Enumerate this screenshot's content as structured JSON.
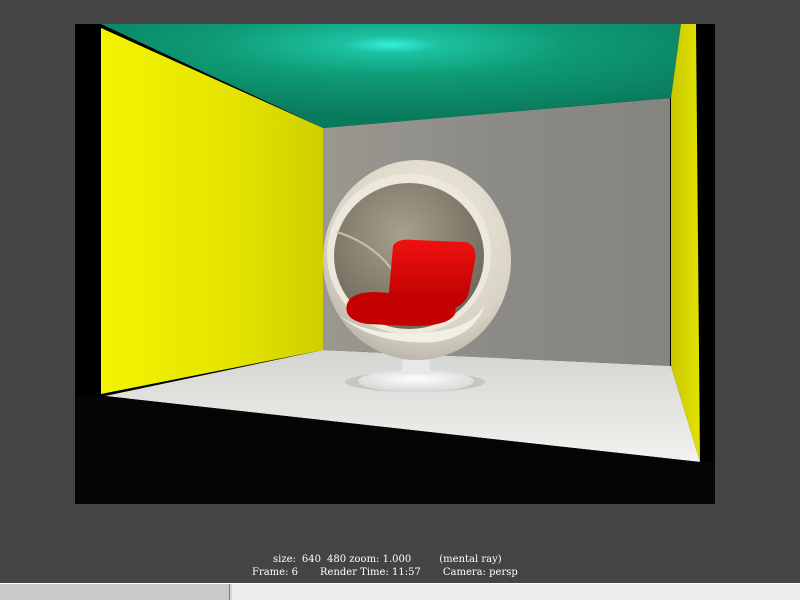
{
  "render_info": {
    "size_label": "size:",
    "size_width": "640",
    "size_height": "480",
    "zoom_label": "zoom:",
    "zoom_value": "1.000",
    "renderer": "(mental ray)",
    "frame_label": "Frame:",
    "frame_value": "6",
    "render_time_label": "Render Time:",
    "render_time_value": "11:57",
    "camera_label": "Camera:",
    "camera_value": "persp"
  },
  "scene": {
    "ceiling_color": "#0c8a68",
    "ceiling_light_color": "#2fe8d0",
    "left_wall_color": "#e6e600",
    "right_wall_color": "#d9d900",
    "back_wall_color": "#8e8c88",
    "floor_color": "#e8e8e6",
    "chair_shell_color": "#dcd6c8",
    "chair_cushion_color": "#d40000"
  }
}
